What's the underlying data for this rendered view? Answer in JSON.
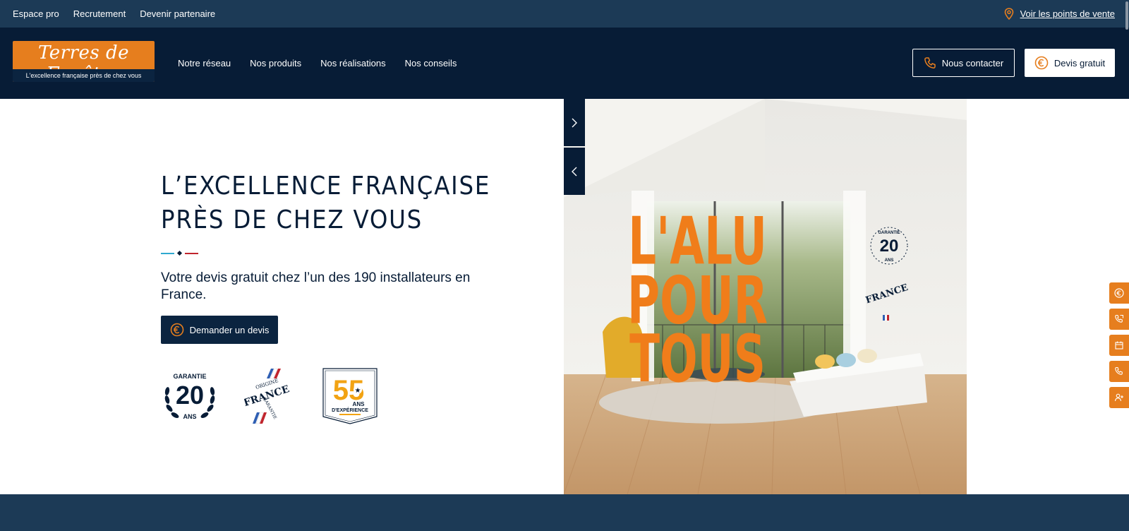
{
  "topbar": {
    "links": [
      "Espace pro",
      "Recrutement",
      "Devenir partenaire"
    ],
    "stores_label": "Voir les points de vente"
  },
  "nav": {
    "logo_text": "Terres de Fenêtre",
    "logo_tagline": "L'excellence française près de chez vous",
    "menu": [
      "Notre réseau",
      "Nos produits",
      "Nos réalisations",
      "Nos conseils"
    ],
    "contact_label": "Nous contacter",
    "devis_label": "Devis gratuit"
  },
  "hero": {
    "title": "L’EXCELLENCE FRANÇAISE PRÈS DE CHEZ VOUS",
    "subtitle": "Votre devis gratuit chez l’un des 190 installateurs en France.",
    "cta_label": "Demander un devis",
    "badges": {
      "garantie_top": "GARANTIE",
      "garantie_num": "20",
      "garantie_bottom": "ANS",
      "origine_top": "ORIGINE",
      "origine_mid": "FRANCE",
      "origine_bottom": "GARANTIE",
      "exp_num": "55",
      "exp_line1": "ANS",
      "exp_line2": "D'EXPÉRIENCE"
    },
    "image": {
      "headline_lines": [
        "L'ALU",
        "POUR",
        "TOUS"
      ],
      "seal_top": "GARANTIE",
      "seal_num": "20",
      "seal_bottom": "ANS",
      "seal2_text": "FRANCE"
    }
  },
  "side_tabs": [
    "euro-icon",
    "phone-call-icon",
    "calendar-icon",
    "phone-icon",
    "user-plus-icon"
  ],
  "colors": {
    "navy": "#071c36",
    "topbar": "#1c3a56",
    "orange": "#e67e1e",
    "tricolor_blue": "#2fa9cf",
    "tricolor_red": "#c0252d"
  }
}
